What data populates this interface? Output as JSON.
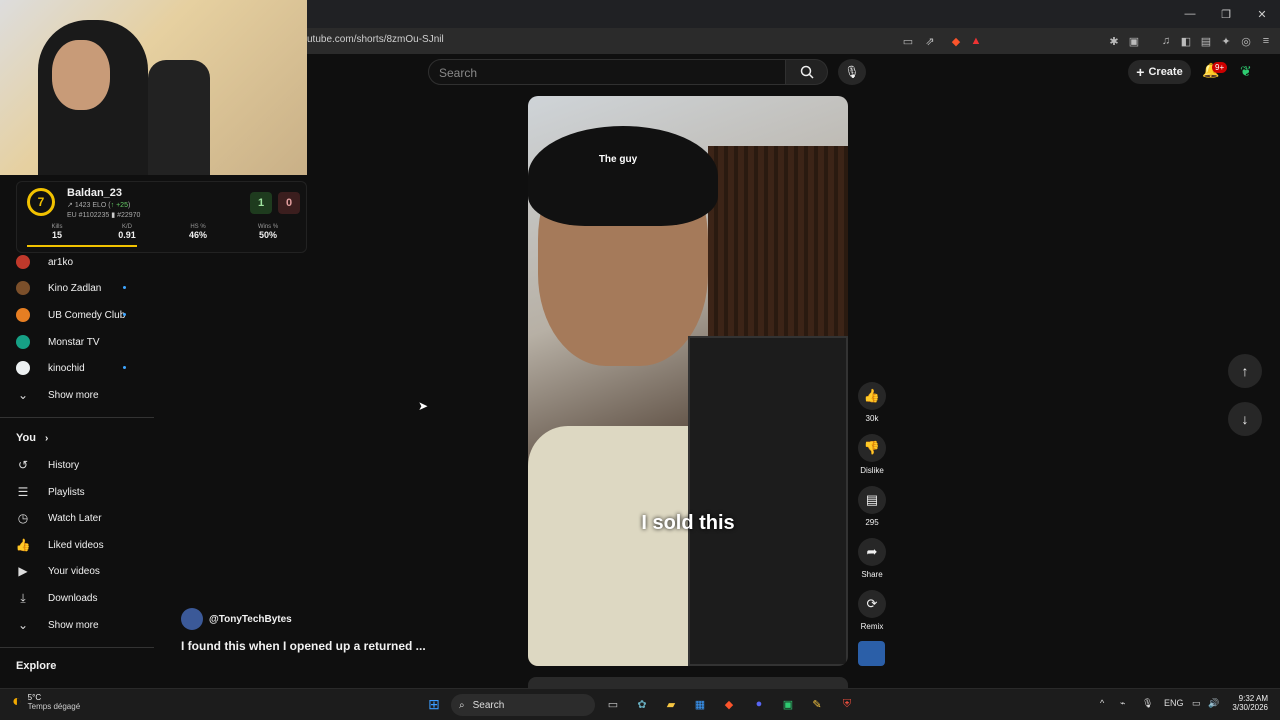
{
  "browser": {
    "url": "utube.com/shorts/8zmOu-SJnil"
  },
  "header": {
    "search_placeholder": "Search",
    "create_label": "Create",
    "notif_badge": "9+"
  },
  "stream_overlay": {
    "level": "7",
    "username": "Baldan_23",
    "elo": "1423 ELO",
    "elo_change": "+25",
    "region_rank": "EU #1102235",
    "country_rank": "#22970",
    "wins": "1",
    "losses": "0",
    "stats": [
      {
        "label": "Kills",
        "value": "15"
      },
      {
        "label": "K/D",
        "value": "0.91"
      },
      {
        "label": "HS %",
        "value": "46%"
      },
      {
        "label": "Wins %",
        "value": "50%"
      }
    ]
  },
  "sidebar": {
    "subscriptions": [
      {
        "label": "ar1ko",
        "color": "#c0392b",
        "new": false
      },
      {
        "label": "Kino Zadlan",
        "color": "#7b4f2a",
        "new": true
      },
      {
        "label": "UB Comedy Club",
        "color": "#e67e22",
        "new": true
      },
      {
        "label": "Monstar TV",
        "color": "#16a085",
        "new": false
      },
      {
        "label": "kinochid",
        "color": "#ecf0f1",
        "new": true
      }
    ],
    "show_more_1": "Show more",
    "you_label": "You",
    "you_items": [
      {
        "label": "History",
        "icon": "↺"
      },
      {
        "label": "Playlists",
        "icon": "☰"
      },
      {
        "label": "Watch Later",
        "icon": "◷"
      },
      {
        "label": "Liked videos",
        "icon": "👍"
      },
      {
        "label": "Your videos",
        "icon": "▶"
      },
      {
        "label": "Downloads",
        "icon": "⤓"
      }
    ],
    "show_more_2": "Show more",
    "explore_label": "Explore"
  },
  "video": {
    "caption_top": "The guy",
    "caption_main": "I sold this",
    "channel": "@TonyTechBytes",
    "title": "I found this when I opened up a returned ...",
    "likes": "30k",
    "dislike_label": "Dislike",
    "comments": "295",
    "share_label": "Share",
    "remix_label": "Remix"
  },
  "taskbar": {
    "temp": "5°C",
    "weather_desc": "Temps dégagé",
    "search_label": "Search",
    "lang": "ENG",
    "time": "9:32 AM",
    "date": "3/30/2026"
  }
}
